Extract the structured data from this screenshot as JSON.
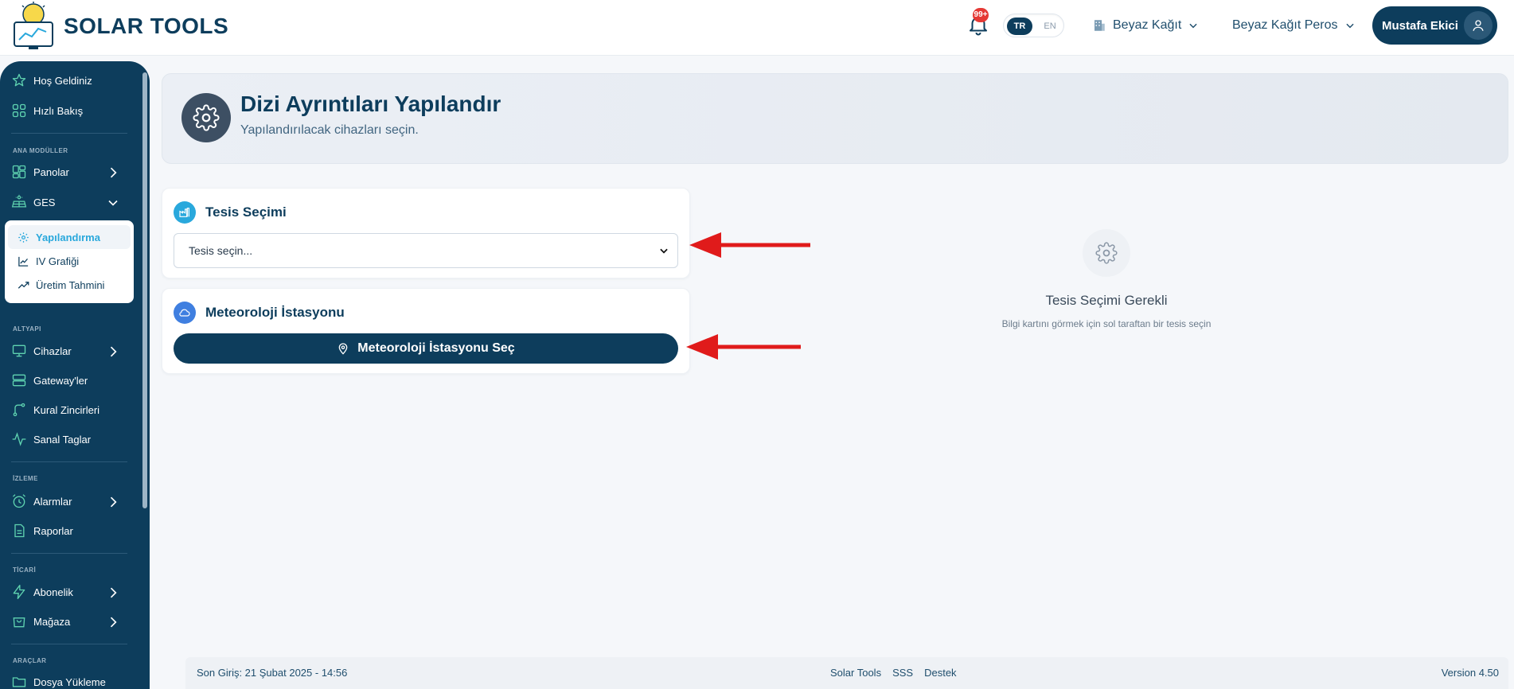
{
  "brand": {
    "name": "SOLAR TOOLS"
  },
  "header": {
    "notification_count": "99+",
    "lang_active": "TR",
    "lang_other": "EN",
    "org_primary": "Beyaz Kağıt",
    "org_secondary": "Beyaz Kağıt Peros",
    "user_name": "Mustafa Ekici"
  },
  "sidebar": {
    "top_items": [
      {
        "label": "Hoş Geldiniz",
        "icon": "star-icon"
      },
      {
        "label": "Hızlı Bakış",
        "icon": "grid-icon"
      }
    ],
    "sections": {
      "main_modules": "ANA MODÜLLER",
      "infrastructure": "ALTYAPI",
      "monitoring": "İZLEME",
      "commercial": "TİCARİ",
      "tools": "ARAÇLAR"
    },
    "main_items": [
      {
        "label": "Panolar",
        "icon": "dashboard-icon"
      },
      {
        "label": "GES",
        "icon": "solar-panel-icon"
      }
    ],
    "ges_sub": [
      {
        "label": "Yapılandırma",
        "icon": "gear-icon",
        "active": true
      },
      {
        "label": "IV Grafiği",
        "icon": "chart-line-icon"
      },
      {
        "label": "Üretim Tahmini",
        "icon": "trend-icon"
      }
    ],
    "infra_items": [
      {
        "label": "Cihazlar",
        "icon": "monitor-icon"
      },
      {
        "label": "Gateway'ler",
        "icon": "server-icon"
      },
      {
        "label": "Kural Zincirleri",
        "icon": "branch-icon"
      },
      {
        "label": "Sanal Taglar",
        "icon": "pulse-icon"
      }
    ],
    "monitoring_items": [
      {
        "label": "Alarmlar",
        "icon": "alarm-icon"
      },
      {
        "label": "Raporlar",
        "icon": "report-icon"
      }
    ],
    "commercial_items": [
      {
        "label": "Abonelik",
        "icon": "bolt-icon"
      },
      {
        "label": "Mağaza",
        "icon": "store-icon"
      }
    ],
    "tools_items": [
      {
        "label": "Dosya Yükleme",
        "icon": "folder-icon"
      }
    ]
  },
  "page": {
    "title": "Dizi Ayrıntıları Yapılandır",
    "subtitle": "Yapılandırılacak cihazları seçin."
  },
  "facility_card": {
    "title": "Tesis Seçimi",
    "select_placeholder": "Tesis seçin..."
  },
  "weather_card": {
    "title": "Meteoroloji İstasyonu",
    "button_label": "Meteoroloji İstasyonu Seç"
  },
  "empty_state": {
    "title": "Tesis Seçimi Gerekli",
    "description": "Bilgi kartını görmek için sol taraftan bir tesis seçin"
  },
  "footer": {
    "last_login": "Son Giriş: 21 Şubat 2025 - 14:56",
    "links": [
      "Solar Tools",
      "SSS",
      "Destek"
    ],
    "version": "Version 4.50"
  },
  "colors": {
    "primary": "#0d3d5c",
    "accent": "#29a8dc",
    "alert": "#e53935"
  }
}
